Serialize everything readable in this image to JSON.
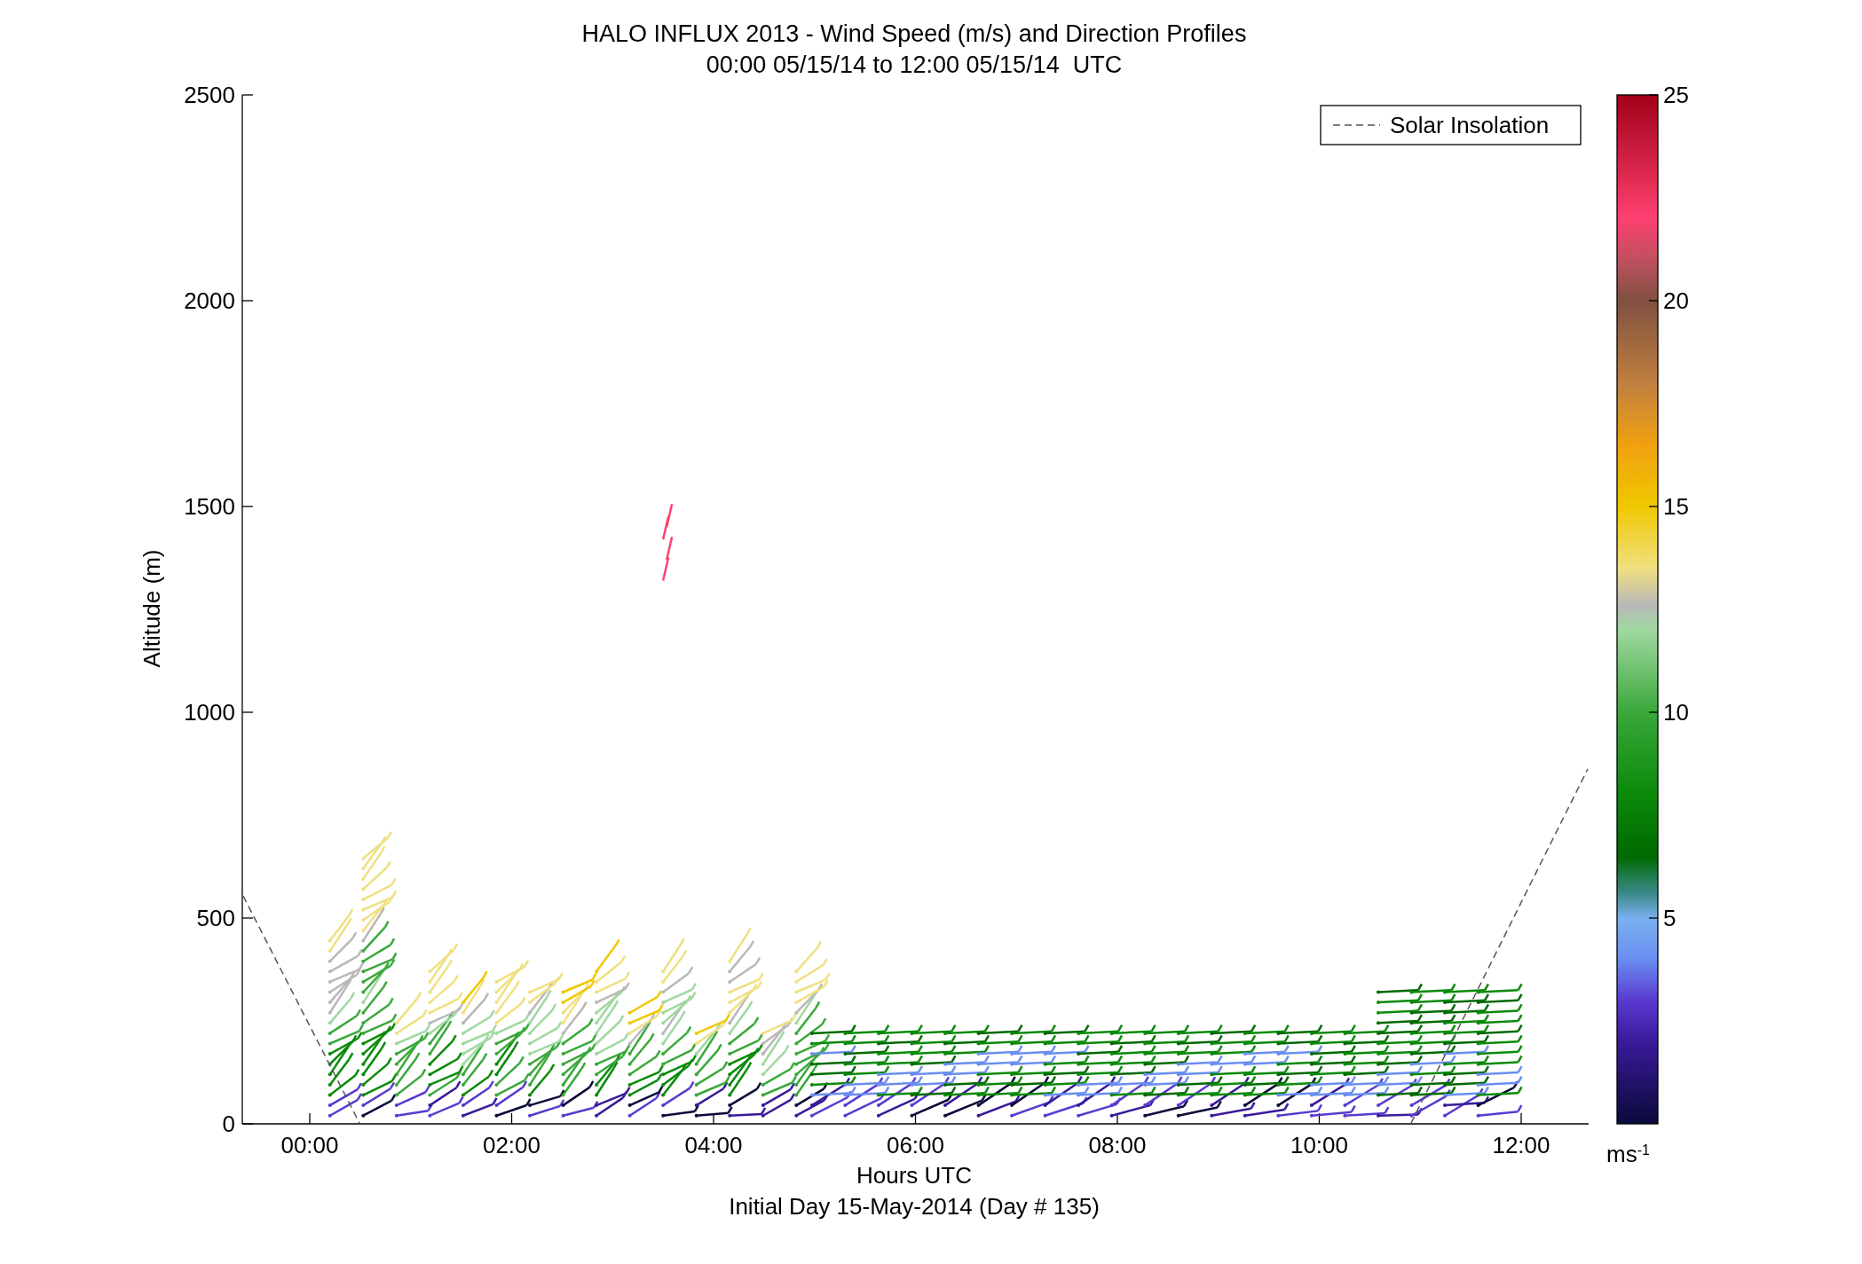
{
  "title": {
    "line_1": "HALO INFLUX 2013 - Wind Speed (m/s) and Direction Profiles",
    "line_2": "00:00 05/15/14 to 12:00 05/15/14  UTC"
  },
  "y_axis": {
    "label": "Altitude (m)",
    "ticks": [
      "2500",
      "2000",
      "1500",
      "1000",
      "500",
      "0"
    ]
  },
  "x_axis": {
    "label": "Hours UTC",
    "ticks": [
      "00:00",
      "02:00",
      "04:00",
      "06:00",
      "08:00",
      "10:00",
      "12:00"
    ]
  },
  "subtitle": "Initial Day 15-May-2014 (Day # 135)",
  "legend": {
    "entries": [
      {
        "label": "Solar Insolation"
      }
    ]
  },
  "colorbar": {
    "ticks": [
      "25",
      "20",
      "15",
      "10",
      "5"
    ],
    "unit": "ms$^{-1}$"
  }
}
